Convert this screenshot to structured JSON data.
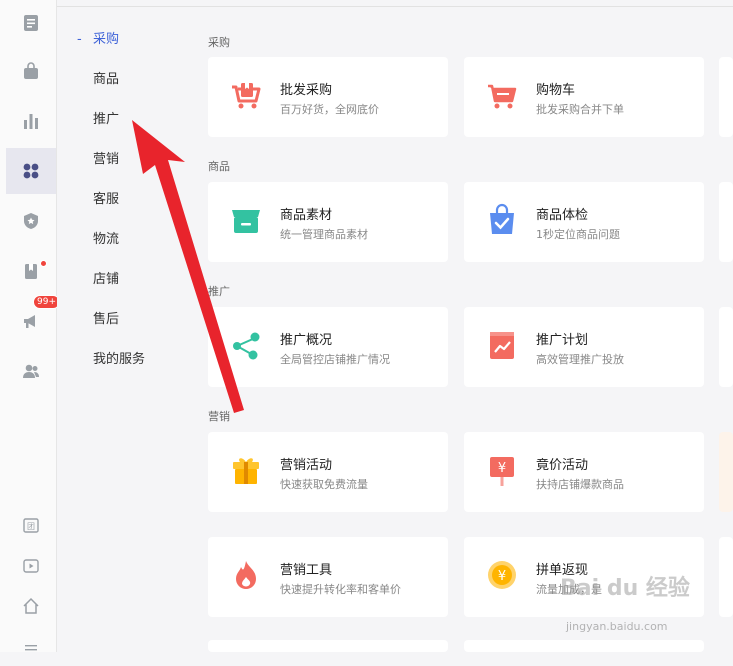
{
  "rail": {
    "badge_count": "99+"
  },
  "subnav": {
    "items": [
      "采购",
      "商品",
      "推广",
      "营销",
      "客服",
      "物流",
      "店铺",
      "售后",
      "我的服务"
    ]
  },
  "sections": {
    "caigou": "采购",
    "shangpin": "商品",
    "tuiguang": "推广",
    "yingxiao": "营销"
  },
  "cards": {
    "pifa": {
      "title": "批发采购",
      "sub": "百万好货，全网底价"
    },
    "gouwuche": {
      "title": "购物车",
      "sub": "批发采购合并下单"
    },
    "sucai": {
      "title": "商品素材",
      "sub": "统一管理商品素材"
    },
    "tijian": {
      "title": "商品体检",
      "sub": "1秒定位商品问题"
    },
    "gaikuang": {
      "title": "推广概况",
      "sub": "全局管控店铺推广情况"
    },
    "jihua": {
      "title": "推广计划",
      "sub": "高效管理推广投放"
    },
    "huodong": {
      "title": "营销活动",
      "sub": "快速获取免费流量"
    },
    "jingjia": {
      "title": "竟价活动",
      "sub": "扶持店铺爆款商品"
    },
    "gongju": {
      "title": "营销工具",
      "sub": "快速提升转化率和客单价"
    },
    "fanxian": {
      "title": "拼单返现",
      "sub": "流量加成，是"
    }
  },
  "watermark": {
    "brand": "Bai du 经验",
    "url": "jingyan.baidu.com"
  },
  "colors": {
    "accent": "#3f63d8",
    "arrow": "#e8242c",
    "badge": "#f0443c"
  }
}
